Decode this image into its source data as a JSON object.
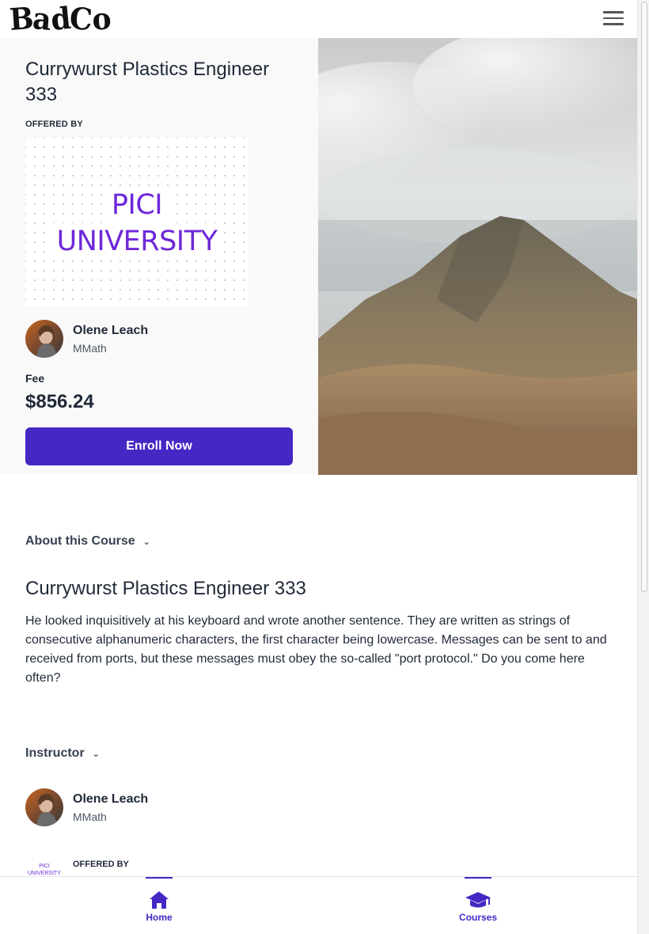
{
  "header": {
    "logo_text": "BadCo",
    "menu_icon": "hamburger-menu-icon"
  },
  "course": {
    "title": "Currywurst Plastics Engineer 333",
    "offered_by_label": "OFFERED BY",
    "university_line1": "PICI",
    "university_line2": "UNIVERSITY",
    "instructor_name": "Olene Leach",
    "instructor_degree": "MMath",
    "fee_label": "Fee",
    "fee_value": "$856.24",
    "enroll_label": "Enroll Now"
  },
  "about": {
    "heading": "About this Course",
    "title": "Currywurst Plastics Engineer 333",
    "body": "He looked inquisitively at his keyboard and wrote another sentence. They are written as strings of consecutive alphanumeric characters, the first character being lowercase. Messages can be sent to and received from ports, but these messages must obey the so-called \"port protocol.\" Do you come here often?"
  },
  "instructor_section": {
    "heading": "Instructor",
    "name": "Olene Leach",
    "degree": "MMath",
    "offered_by_label": "OFFERED BY",
    "uni_thumb_line1": "PICI",
    "uni_thumb_line2": "UNIVERSITY"
  },
  "bottom_nav": {
    "items": [
      {
        "label": "Home",
        "icon": "home-icon"
      },
      {
        "label": "Courses",
        "icon": "graduation-cap-icon"
      }
    ]
  },
  "colors": {
    "accent": "#4527c4",
    "university_purple": "#6d28d9"
  }
}
